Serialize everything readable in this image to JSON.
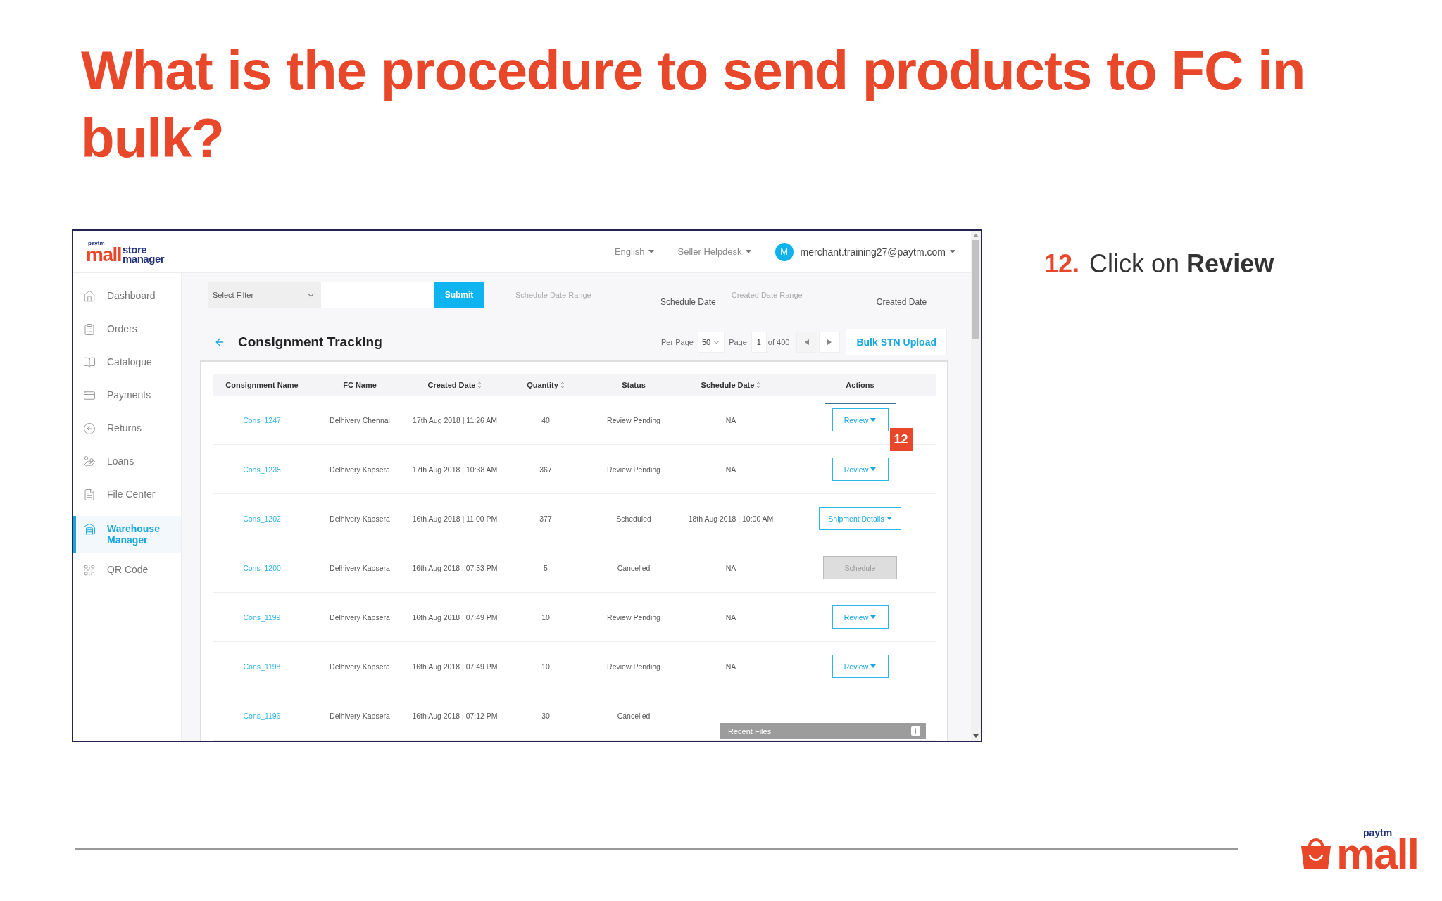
{
  "slide": {
    "title": "What is the procedure to send products to FC in bulk?",
    "step": {
      "number": "12.",
      "text": "Click on **Review**"
    }
  },
  "app": {
    "logo": {
      "small": "paytm",
      "brand": "mall",
      "line1": "store",
      "line2": "manager"
    },
    "header": {
      "language": "English",
      "helpdesk": "Seller Helpdesk",
      "avatar": "M",
      "email": "merchant.training27@paytm.com"
    },
    "sidebar": {
      "items": [
        {
          "label": "Dashboard",
          "selected": false
        },
        {
          "label": "Orders",
          "selected": false
        },
        {
          "label": "Catalogue",
          "selected": false
        },
        {
          "label": "Payments",
          "selected": false
        },
        {
          "label": "Returns",
          "selected": false
        },
        {
          "label": "Loans",
          "selected": false
        },
        {
          "label": "File Center",
          "selected": false
        },
        {
          "label": "Warehouse Manager",
          "selected": true
        },
        {
          "label": "QR Code",
          "selected": false
        }
      ]
    },
    "filters": {
      "select": "Select Filter",
      "submit": "Submit",
      "schedule_range_placeholder": "Schedule Date Range",
      "schedule_label": "Schedule Date",
      "created_range_placeholder": "Created Date Range",
      "created_label": "Created Date"
    },
    "page_title": "Consignment Tracking",
    "pagination": {
      "per_page_label": "Per Page",
      "per_page": "50",
      "page_label": "Page",
      "page": "1",
      "of_pages": "of 400",
      "upload": "Bulk STN Upload"
    },
    "table": {
      "columns": [
        {
          "label": "Consignment Name",
          "sortable": false
        },
        {
          "label": "FC Name",
          "sortable": false
        },
        {
          "label": "Created Date",
          "sortable": true
        },
        {
          "label": "Quantity",
          "sortable": true
        },
        {
          "label": "Status",
          "sortable": false
        },
        {
          "label": "Schedule Date",
          "sortable": true
        },
        {
          "label": "Actions",
          "sortable": false
        }
      ],
      "rows": [
        {
          "name": "Cons_1247",
          "fc": "Delhivery Chennai",
          "created": "17th Aug 2018 | 11:26 AM",
          "quantity": "40",
          "status": "Review Pending",
          "schedule": "NA",
          "action": {
            "label": "Review",
            "kind": "dropdown",
            "callout": "12"
          }
        },
        {
          "name": "Cons_1235",
          "fc": "Delhivery Kapsera",
          "created": "17th Aug 2018 | 10:38 AM",
          "quantity": "367",
          "status": "Review Pending",
          "schedule": "NA",
          "action": {
            "label": "Review",
            "kind": "dropdown"
          }
        },
        {
          "name": "Cons_1202",
          "fc": "Delhivery Kapsera",
          "created": "16th Aug 2018 | 11:00 PM",
          "quantity": "377",
          "status": "Scheduled",
          "schedule": "18th Aug 2018 | 10:00 AM",
          "action": {
            "label": "Shipment Details",
            "kind": "dropdown"
          }
        },
        {
          "name": "Cons_1200",
          "fc": "Delhivery Kapsera",
          "created": "16th Aug 2018 | 07:53 PM",
          "quantity": "5",
          "status": "Cancelled",
          "schedule": "NA",
          "action": {
            "label": "Schedule",
            "kind": "disabled"
          }
        },
        {
          "name": "Cons_1199",
          "fc": "Delhivery Kapsera",
          "created": "16th Aug 2018 | 07:49 PM",
          "quantity": "10",
          "status": "Review Pending",
          "schedule": "NA",
          "action": {
            "label": "Review",
            "kind": "dropdown"
          }
        },
        {
          "name": "Cons_1198",
          "fc": "Delhivery Kapsera",
          "created": "16th Aug 2018 | 07:49 PM",
          "quantity": "10",
          "status": "Review Pending",
          "schedule": "NA",
          "action": {
            "label": "Review",
            "kind": "dropdown"
          }
        },
        {
          "name": "Cons_1196",
          "fc": "Delhivery Kapsera",
          "created": "16th Aug 2018 | 07:12 PM",
          "quantity": "30",
          "status": "Cancelled"
        }
      ]
    },
    "recent_files": "Recent Files"
  },
  "footer_logo": {
    "small": "paytm",
    "brand": "mall"
  }
}
